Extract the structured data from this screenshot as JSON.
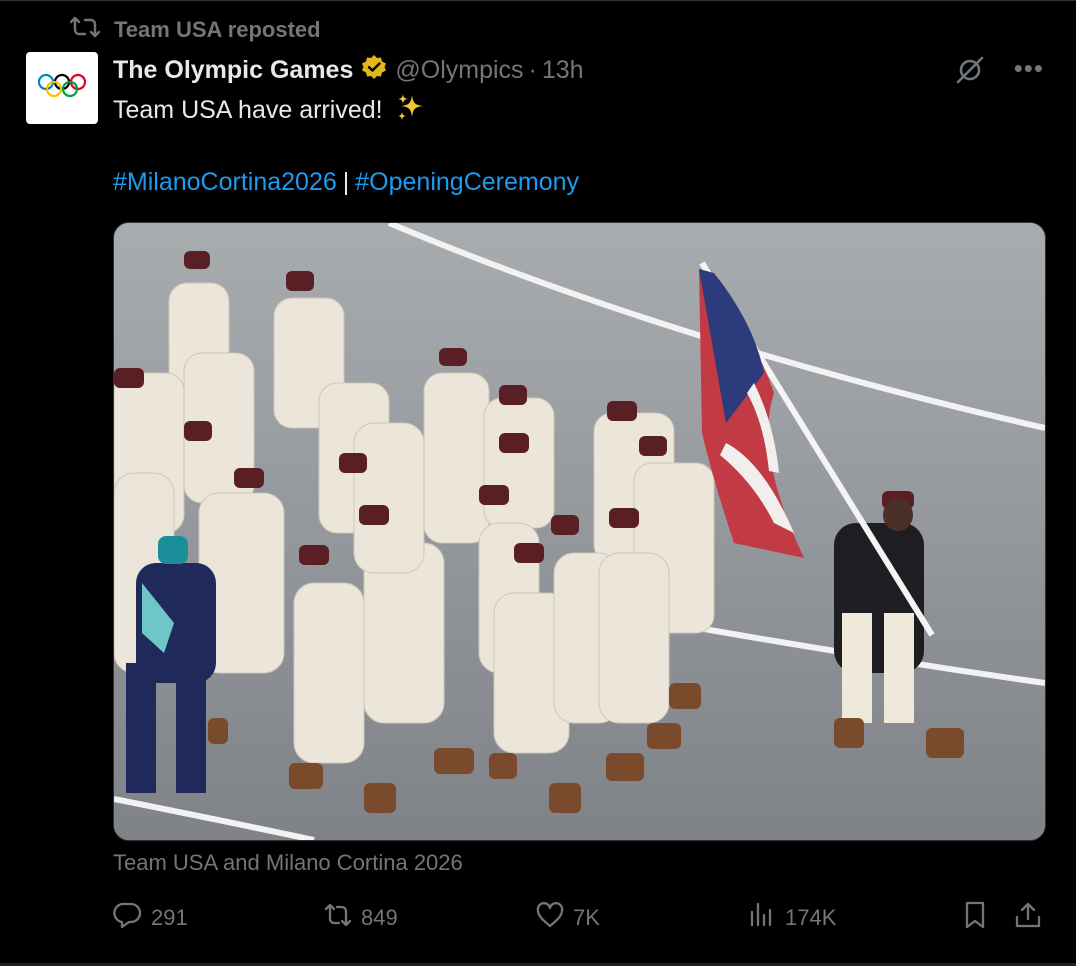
{
  "repost": {
    "label": "Team USA reposted"
  },
  "author": {
    "name": "The Olympic Games",
    "handle": "@Olympics",
    "separator": "·",
    "time": "13h"
  },
  "tweet": {
    "text": "Team USA have arrived!",
    "emoji": "sparkles-icon",
    "hashtags": [
      "#MilanoCortina2026",
      "#OpeningCeremony"
    ],
    "separator": "|"
  },
  "media": {
    "caption": "Team USA and Milano Cortina 2026"
  },
  "stats": {
    "replies": "291",
    "reposts": "849",
    "likes": "7K",
    "views": "174K"
  },
  "colors": {
    "accent": "#1d9bf0",
    "muted": "#71767b",
    "verified_gold": "#e2b719",
    "background": "#000000"
  },
  "icons": [
    "repost-icon",
    "olympic-rings-icon",
    "verified-badge-icon",
    "grok-icon",
    "more-icon",
    "reply-icon",
    "like-icon",
    "views-icon",
    "bookmark-icon",
    "share-icon"
  ]
}
